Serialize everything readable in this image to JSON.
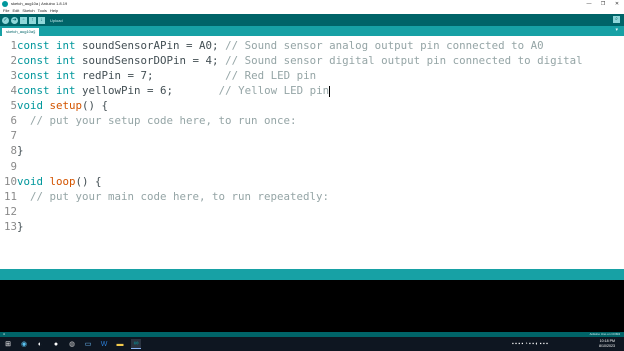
{
  "window": {
    "title": "sketch_aug10a | Arduino 1.8.19",
    "controls": [
      "—",
      "❐",
      "✕"
    ]
  },
  "menu": [
    "File",
    "Edit",
    "Sketch",
    "Tools",
    "Help"
  ],
  "toolbar": {
    "status_label": "Upload",
    "buttons": [
      "verify-icon",
      "upload-icon",
      "new-icon",
      "open-icon",
      "save-icon"
    ],
    "serial_monitor": "serial-monitor-icon"
  },
  "tab": {
    "name": "sketch_aug10a§",
    "menu_glyph": "▾"
  },
  "code": {
    "line_numbers": [
      "1",
      "2",
      "3",
      "4",
      "5",
      "6",
      "7",
      "8",
      "9",
      "10",
      "11",
      "12",
      "13"
    ],
    "l1": {
      "kw1": "const",
      "kw2": "int",
      "rest": " soundSensorAPin = A0; ",
      "cm": "// Sound sensor analog output pin connected to A0"
    },
    "l2": {
      "kw1": "const",
      "kw2": "int",
      "rest": " soundSensorDOPin = 4; ",
      "cm": "// Sound sensor digital output pin connected to digital"
    },
    "l3": {
      "kw1": "const",
      "kw2": "int",
      "rest": " redPin = 7;           ",
      "cm": "// Red LED pin"
    },
    "l4": {
      "kw1": "const",
      "kw2": "int",
      "rest": " yellowPin = 6;       ",
      "cm": "// Yellow LED pin"
    },
    "l5": {
      "kw1": "void",
      "fn": "setup",
      "rest": "() {"
    },
    "l6": {
      "cm": "  // put your setup code here, to run once:"
    },
    "l8": {
      "rest": "}"
    },
    "l10": {
      "kw1": "void",
      "fn": "loop",
      "rest": "() {"
    },
    "l11": {
      "cm": "  // put your main code here, to run repeatedly:"
    },
    "l13": {
      "rest": "}"
    }
  },
  "bottom_status": {
    "line": "4",
    "board": "Arduino Uno on COM4"
  },
  "taskbar": {
    "time": "10:18 PM",
    "date": "8/10/2023",
    "apps": [
      "windows-icon",
      "search-icon",
      "browser-icon",
      "chrome-icon",
      "file-explorer-icon",
      "mail-icon",
      "word-icon",
      "folder-icon",
      "arduino-icon"
    ]
  }
}
